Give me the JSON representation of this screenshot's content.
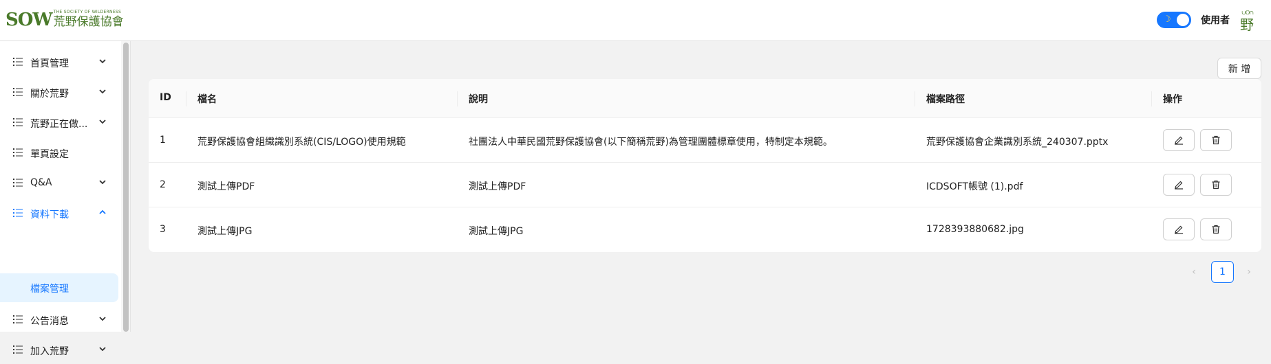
{
  "header": {
    "logo_mark": "SOW",
    "logo_en": "THE SOCIETY OF WILDERNESS",
    "logo_zh": "荒野保護協會",
    "user_label": "使用者",
    "avatar_text": "野"
  },
  "sidebar": {
    "items": [
      {
        "label": "首頁管理"
      },
      {
        "label": "關於荒野"
      },
      {
        "label": "荒野正在做..."
      },
      {
        "label": "單頁設定"
      },
      {
        "label": "Q&A"
      },
      {
        "label": "資料下載"
      },
      {
        "label": "公告消息"
      },
      {
        "label": "加入荒野"
      }
    ],
    "sub_item": {
      "label": "檔案管理"
    }
  },
  "toolbar": {
    "add_label": "新 增"
  },
  "table": {
    "columns": [
      "ID",
      "檔名",
      "說明",
      "檔案路徑",
      "操作"
    ],
    "rows": [
      {
        "id": "1",
        "name": "荒野保護協會組織識別系統(CIS/LOGO)使用規範",
        "desc": "社團法人中華民國荒野保護協會(以下簡稱荒野)為管理團體標章使用，特制定本規範。",
        "path": "荒野保護協會企業識別系統_240307.pptx"
      },
      {
        "id": "2",
        "name": "測試上傳PDF",
        "desc": "測試上傳PDF",
        "path": "ICDSOFT帳號 (1).pdf"
      },
      {
        "id": "3",
        "name": "測試上傳JPG",
        "desc": "測試上傳JPG",
        "path": "1728393880682.jpg"
      }
    ]
  },
  "pagination": {
    "prev": "‹",
    "current": "1",
    "next": "›"
  },
  "colors": {
    "accent": "#1677ff",
    "brand": "#4a7a2a"
  }
}
